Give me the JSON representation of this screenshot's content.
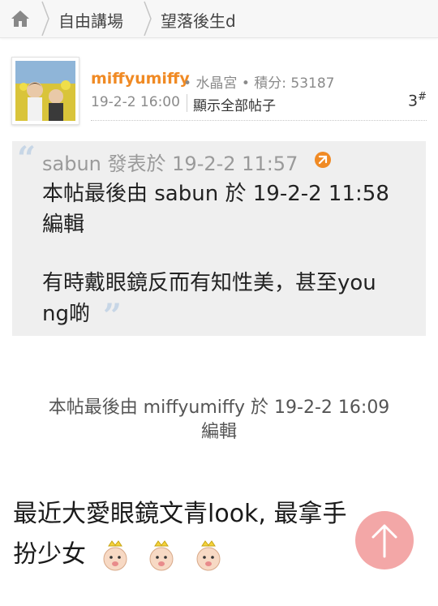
{
  "breadcrumb": {
    "home_icon": "home-icon",
    "items": [
      "自由講場",
      "望落後生d"
    ]
  },
  "post": {
    "username": "miffyumiffy",
    "group": "水晶宮",
    "score_label": "積分:",
    "score_value": "53187",
    "time": "19-2-2 16:00",
    "show_all_label": "顯示全部帖子",
    "floor_number": "3",
    "floor_mark": "#"
  },
  "quote": {
    "author": "sabun",
    "action": "發表於",
    "time": "19-2-2 11:57",
    "lines": [
      "本帖最後由 sabun 於 19-2-2 11:58",
      "編輯",
      "",
      "有時戴眼鏡反而有知性美，甚至you",
      "ng啲"
    ]
  },
  "edit_note": {
    "line1": "本帖最後由 miffyumiffy 於 19-2-2 16:09",
    "line2": "編輯"
  },
  "content": {
    "line1": "最近大愛眼鏡文青look, 最拿手",
    "line2": "扮少女"
  },
  "colors": {
    "username": "#f08a24",
    "back_to_top": "#f2a0a0",
    "quote_bg": "#efefef"
  }
}
